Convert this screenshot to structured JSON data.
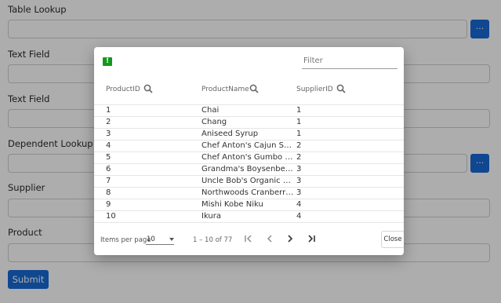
{
  "form": {
    "fields": [
      {
        "label": "Table Lookup",
        "value": ""
      },
      {
        "label": "Text Field",
        "value": ""
      },
      {
        "label": "Text Field",
        "value": ""
      },
      {
        "label": "Dependent Lookup",
        "value": ""
      },
      {
        "label": "Supplier",
        "value": ""
      },
      {
        "label": "Product",
        "value": ""
      }
    ],
    "lookup_button_label": "...",
    "submit_label": "Submit"
  },
  "dialog": {
    "filter_placeholder": "Filter",
    "columns": [
      "ProductID",
      "ProductName",
      "SupplierID"
    ],
    "rows": [
      [
        "1",
        "Chai",
        "1"
      ],
      [
        "2",
        "Chang",
        "1"
      ],
      [
        "3",
        "Aniseed Syrup",
        "1"
      ],
      [
        "4",
        "Chef Anton's Cajun Seas...",
        "2"
      ],
      [
        "5",
        "Chef Anton's Gumbo Mix",
        "2"
      ],
      [
        "6",
        "Grandma's Boysenberry ...",
        "3"
      ],
      [
        "7",
        "Uncle Bob's Organic Drie...",
        "3"
      ],
      [
        "8",
        "Northwoods Cranberry S...",
        "3"
      ],
      [
        "9",
        "Mishi Kobe Niku",
        "4"
      ],
      [
        "10",
        "Ikura",
        "4"
      ]
    ],
    "paginator": {
      "items_per_page_label": "Items per page",
      "page_size": "10",
      "range_label": "1 – 10 of 77"
    },
    "close_label": "Close"
  },
  "colors": {
    "primary": "#1769d4",
    "flag": "#119a1c",
    "backdrop": "rgba(0,0,0,0.32)"
  },
  "icons": [
    "flag-icon",
    "search-icon",
    "first-page-icon",
    "previous-page-icon",
    "next-page-icon",
    "last-page-icon",
    "dropdown-arrow-icon"
  ]
}
